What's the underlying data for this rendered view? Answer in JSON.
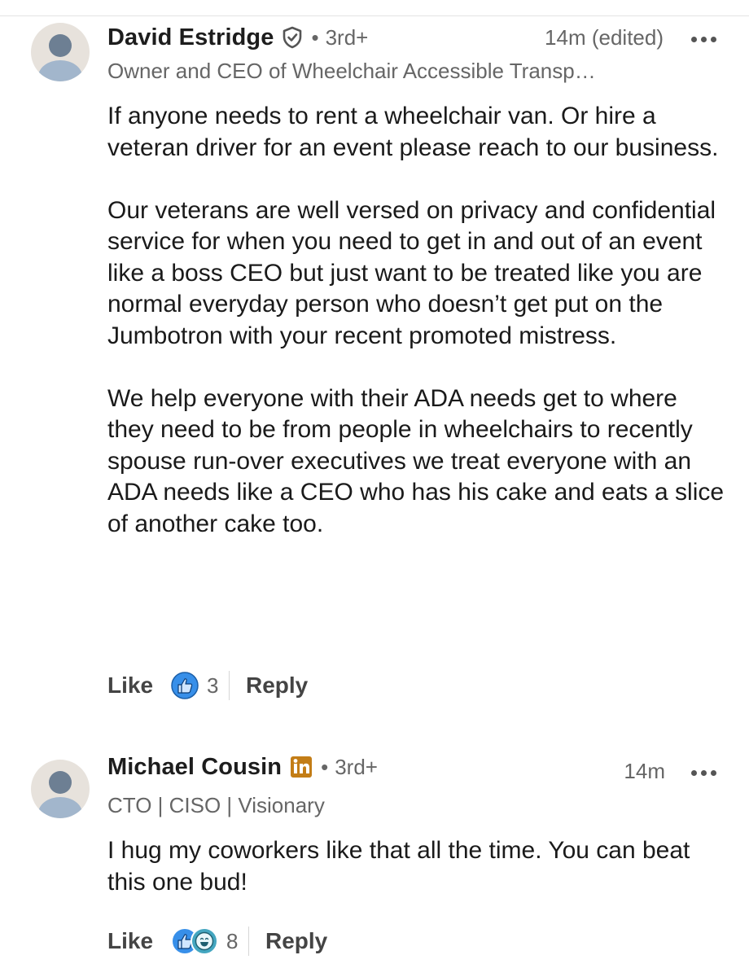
{
  "comments": [
    {
      "author": "David Estridge",
      "badge": "verified-shield-icon",
      "separator": "•",
      "degree": "3rd+",
      "time": "14m (edited)",
      "headline": "Owner and CEO of Wheelchair Accessible Transp…",
      "paragraphs": [
        "If anyone needs to rent a wheelchair van.  Or hire a veteran driver for an event please reach to our business.",
        "Our veterans are well versed on privacy and confidential service for when you need to get in and out of an event like a boss CEO but just want to be treated like you are normal everyday person who doesn’t get put on the Jumbotron with your recent promoted mistress.",
        "We help everyone with their ADA needs get to where they need to be from people in wheelchairs to recently spouse run-over executives we treat everyone with an ADA needs like a CEO who has his cake and eats a slice of another cake too."
      ],
      "like_label": "Like",
      "reaction_icons": [
        "like-reaction-icon"
      ],
      "reaction_count": "3",
      "reply_label": "Reply"
    },
    {
      "author": "Michael Cousin",
      "badge": "linkedin-premium-icon",
      "separator": "•",
      "degree": "3rd+",
      "time": "14m",
      "headline": "CTO | CISO | Visionary",
      "paragraphs": [
        "I hug my coworkers like that all the time. You can beat this one bud!"
      ],
      "like_label": "Like",
      "reaction_icons": [
        "like-reaction-icon",
        "funny-reaction-icon"
      ],
      "reaction_count": "8",
      "reply_label": "Reply"
    }
  ],
  "colors": {
    "like_blue": "#378fe9",
    "funny_teal": "#44a6c0",
    "premium_gold": "#c37d16",
    "secondary_text": "#666666"
  }
}
